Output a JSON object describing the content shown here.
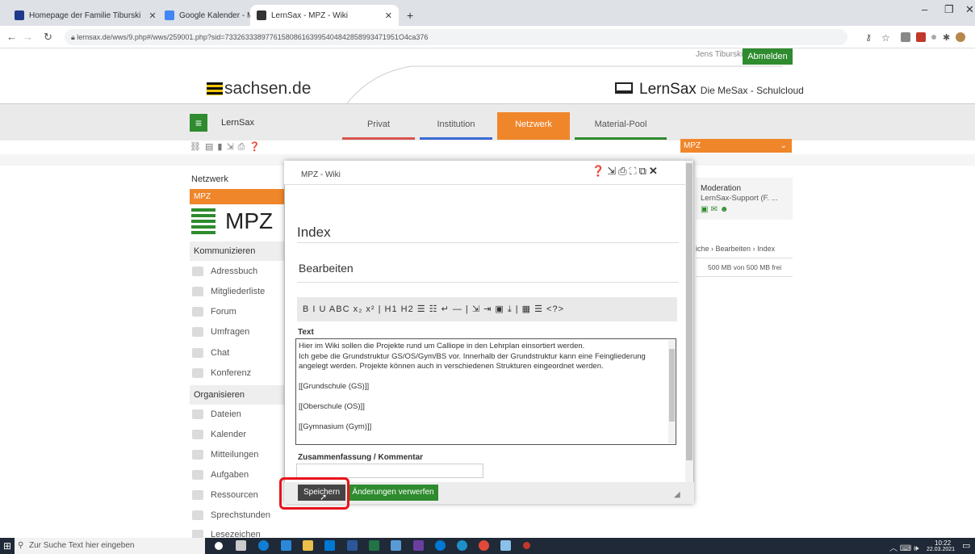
{
  "browser": {
    "tabs": [
      {
        "title": "Homepage der Familie Tiburski"
      },
      {
        "title": "Google Kalender - März 2021"
      },
      {
        "title": "LernSax - MPZ - Wiki"
      }
    ],
    "new_tab": "+",
    "url": "lernsax.de/wws/9.php#/wws/259001.php?sid=7332633389776158086163995404842858993471951O4ca376"
  },
  "header": {
    "user": "Jens Tiburski",
    "logout": "Abmelden",
    "sachsen_logo": "sachsen.de",
    "lernsax_title": "LernSax",
    "lernsax_tagline": "Die MeSax - Schulcloud"
  },
  "nav": {
    "brand": "LernSax",
    "tabs": [
      {
        "label": "Privat",
        "color": "#d9534f"
      },
      {
        "label": "Institution",
        "color": "#3a6bd4"
      },
      {
        "label": "Netzwerk",
        "color": "#f0862a"
      },
      {
        "label": "Material-Pool",
        "color": "#2e8b2e"
      }
    ],
    "network_select": "MPZ"
  },
  "sidebar": {
    "heading": "Netzwerk",
    "active": "MPZ",
    "logo_text": "MPZ",
    "section_kommunizieren": "Kommunizieren",
    "section_organisieren": "Organisieren",
    "items_kommunizieren": [
      "Adressbuch",
      "Mitgliederliste",
      "Forum",
      "Umfragen",
      "Chat",
      "Konferenz"
    ],
    "items_organisieren": [
      "Dateien",
      "Kalender",
      "Mitteilungen",
      "Aufgaben",
      "Ressourcen",
      "Sprechstunden",
      "Lesezeichen"
    ]
  },
  "right": {
    "moderation_title": "Moderation",
    "moderation_name": "LernSax-Support (F. ...",
    "breadcrumb": [
      "iche",
      "Bearbeiten",
      "Index"
    ],
    "quota": "500 MB von 500 MB frei"
  },
  "modal": {
    "title": "MPZ - Wiki",
    "page_title": "Index",
    "edit_heading": "Bearbeiten",
    "toolbar": "B  I  U  ABC  x₂  x²  |  H1  H2  ☰  ☷  ↵  —  |  ⇲  ⇥  ▣  ⤓  |  ▦  ☰  <?>",
    "text_label": "Text",
    "text_value": "Hier im Wiki sollen die Projekte rund um Calliope in den Lehrplan einsortiert werden.\nIch gebe die Grundstruktur GS/OS/Gym/BS vor. Innerhalb der Grundstruktur kann eine Feingliederung angelegt werden. Projekte können auch in verschiedenen Strukturen eingeordnet werden.\n\n[[Grundschule (GS)]]\n\n[[Oberschule (OS)]]\n\n[[Gymnasium (Gym)]]",
    "summary_label": "Zusammenfassung / Kommentar",
    "summary_value": "",
    "save": "Speichern",
    "discard": "Änderungen verwerfen"
  },
  "taskbar": {
    "search_placeholder": "Zur Suche Text hier eingeben",
    "time": "10:22",
    "date": "22.03.2021"
  }
}
